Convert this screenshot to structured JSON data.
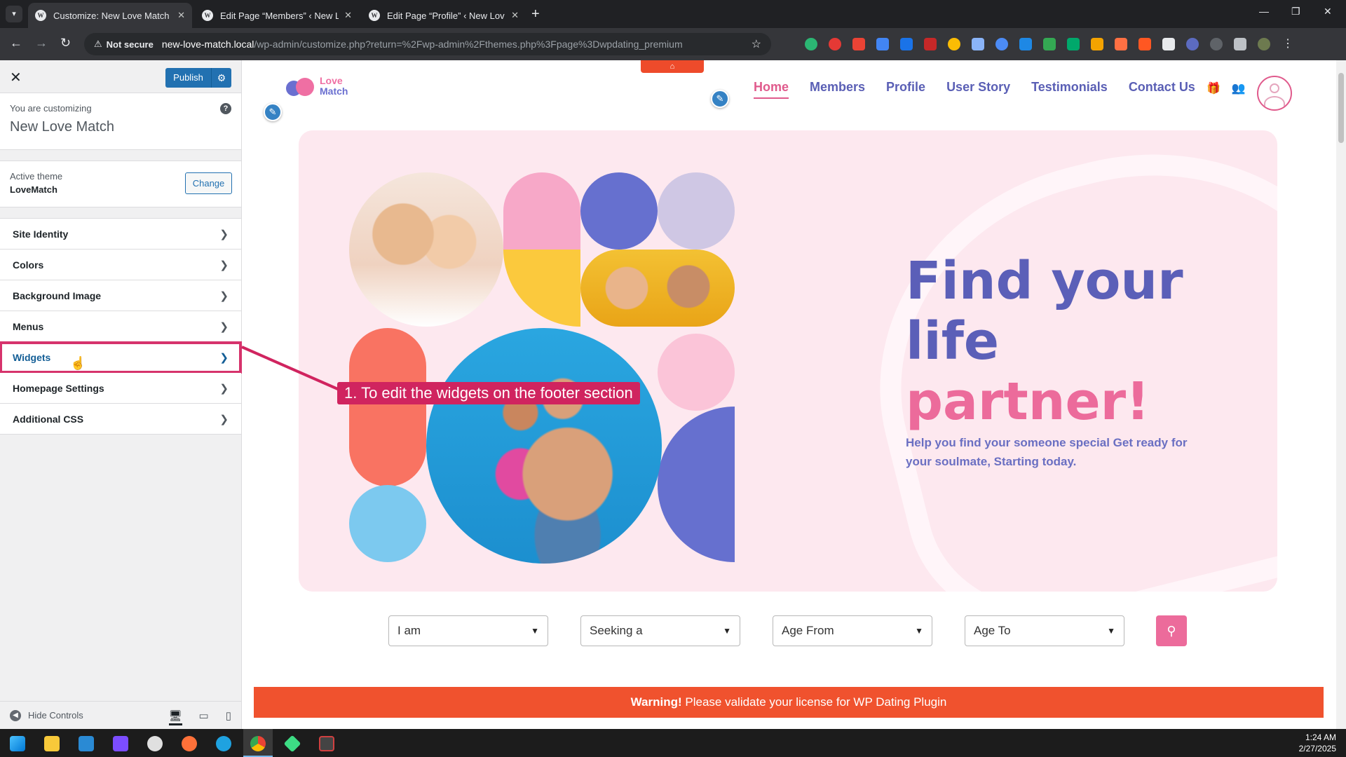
{
  "browser": {
    "tabs": [
      {
        "label": "Customize: New Love Match",
        "active": true
      },
      {
        "label": "Edit Page “Members” ‹ New Lo",
        "active": false
      },
      {
        "label": "Edit Page “Profile” ‹ New Lov",
        "active": false
      }
    ],
    "new_tab": "+",
    "security_label": "Not secure",
    "url_host": "new-love-match.local",
    "url_path": "/wp-admin/customize.php?return=%2Fwp-admin%2Fthemes.php%3Fpage%3Dwpdating_premium"
  },
  "customizer": {
    "publish_label": "Publish",
    "customizing_label": "You are customizing",
    "site_name": "New Love Match",
    "active_theme_label": "Active theme",
    "active_theme_name": "LoveMatch",
    "change_label": "Change",
    "panels": [
      {
        "label": "Site Identity"
      },
      {
        "label": "Colors"
      },
      {
        "label": "Background Image"
      },
      {
        "label": "Menus"
      },
      {
        "label": "Widgets",
        "highlighted": true
      },
      {
        "label": "Homepage Settings"
      },
      {
        "label": "Additional CSS"
      }
    ],
    "hide_controls_label": "Hide Controls"
  },
  "site": {
    "logo_line1": "Love",
    "logo_line2": "Match",
    "nav": [
      "Home",
      "Members",
      "Profile",
      "User Story",
      "Testimonials",
      "Contact Us"
    ],
    "active_nav": "Home",
    "hero_title_line1": "Find your",
    "hero_title_line2": "life",
    "hero_title_line3": "partner!",
    "hero_subtitle": "Help you find your someone special Get ready for your soulmate, Starting today.",
    "search_fields": [
      "I am",
      "Seeking a",
      "Age From",
      "Age To"
    ],
    "warning_strong": "Warning!",
    "warning_text": " Please validate your license for WP Dating Plugin"
  },
  "annotation": {
    "callout": "1. To edit the widgets on the footer section"
  },
  "taskbar": {
    "time": "1:24 AM",
    "date": "2/27/2025"
  },
  "colors": {
    "accent_pink": "#ec6b9b",
    "accent_blue": "#5b5fb8",
    "wp_blue": "#2271b1",
    "warning": "#f0522e",
    "callout": "#d0245f"
  }
}
